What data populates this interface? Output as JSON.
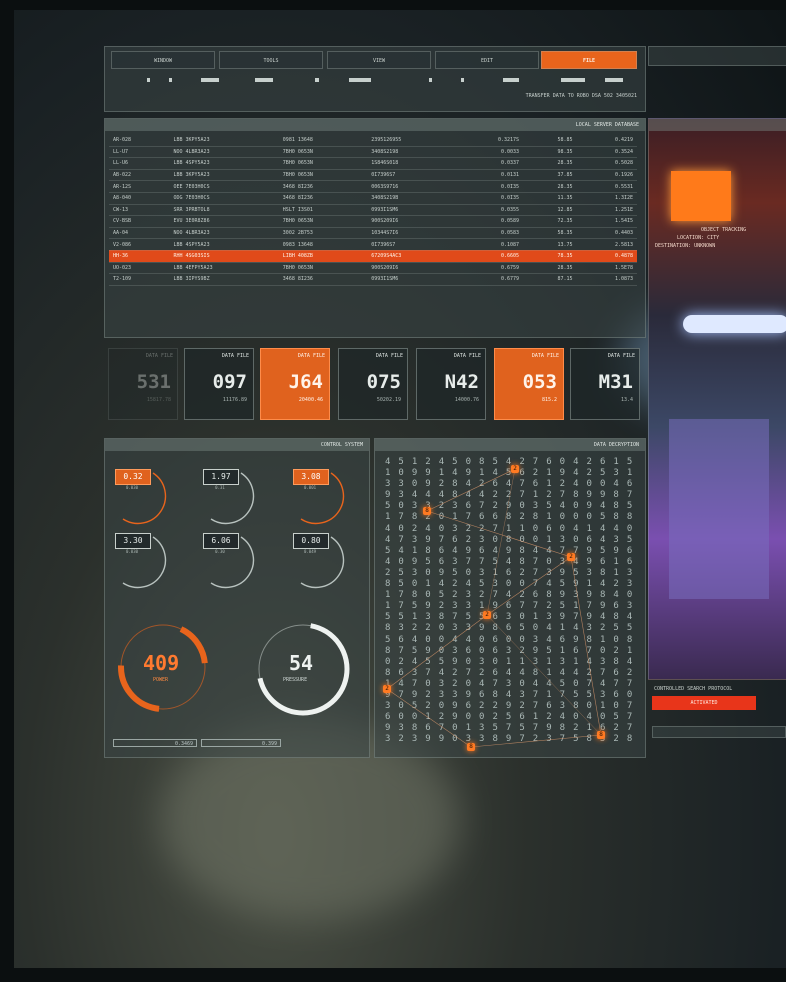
{
  "menu": {
    "items": [
      "WINDOW",
      "TOOLS",
      "VIEW",
      "EDIT",
      "FILE"
    ],
    "active": "FILE"
  },
  "transfer_text": "TRANSFER DATA TO ROBO DSA 502 3405021",
  "database": {
    "title": "LOCAL SERVER DATABASE",
    "rows": [
      [
        "AR-028",
        "LBB 3KPY5A23",
        "0981 13648",
        "2395126955",
        "0.3217S",
        "58.85",
        "0.4219"
      ],
      [
        "LL-U7",
        "NOO 4LBR3A23",
        "7BH0 0653N",
        "3408S2198",
        "0.0033",
        "98.35",
        "0.3524"
      ],
      [
        "LL-U6",
        "LBB 4SPY5A23",
        "7BH0 0653N",
        "1S846S018",
        "0.0337",
        "28.35",
        "0.5028"
      ],
      [
        "AB-022",
        "LBB 3KPY5A23",
        "7BH0 0653N",
        "0I7396S7",
        "0.0131",
        "37.85",
        "0.1926"
      ],
      [
        "AR-12S",
        "OEE 7E03H0CS",
        "3468 8I236",
        "0063S9716",
        "0.0I35",
        "28.35",
        "0.5531"
      ],
      [
        "A8-040",
        "ODG 7E03H0CS",
        "3468 8I236",
        "3408S219B",
        "0.0I35",
        "11.35",
        "1.3I2E"
      ],
      [
        "CW-13",
        "SRR 3PRBTOL8",
        "HSLT I3S01",
        "0993I1SM6",
        "0.0355",
        "12.85",
        "1.251E"
      ],
      [
        "CV-BSB",
        "EVU 3E0R8Z86",
        "7BH0 0653N",
        "900S209I6",
        "0.0589",
        "72.35",
        "1.54I5"
      ],
      [
        "AA-04",
        "NOO 4LBR3A23",
        "3002 2B753",
        "10344S7I6",
        "0.0583",
        "58.35",
        "0.4403"
      ],
      [
        "V2-086",
        "LBB 4SPY5A23",
        "0983 13648",
        "0I7396S7",
        "0.1087",
        "13.75",
        "2.5813"
      ],
      [
        "HH-36",
        "RHH 4SG03SIS",
        "LIBH 408ZB",
        "67209S4AC3",
        "0.6605",
        "78.35",
        "0.4878"
      ],
      [
        "UO-023",
        "LBB 4EFPY5A23",
        "7BH0 0653N",
        "900S209I6",
        "0.6759",
        "28.35",
        "1.5E78"
      ],
      [
        "T2-109",
        "LBB 3IPYS9BZ",
        "3468 8I236",
        "0993I1SM6",
        "0.6779",
        "87.15",
        "1.0873"
      ]
    ],
    "highlight_row": 10
  },
  "data_files": [
    {
      "label": "DATA FILE",
      "code": "M31",
      "sub": "13.4",
      "orange": false
    },
    {
      "label": "DATA FILE",
      "code": "053",
      "sub": "815.2",
      "orange": true
    },
    {
      "label": "DATA FILE",
      "code": "N42",
      "sub": "14000.76",
      "orange": false
    },
    {
      "label": "DATA FILE",
      "code": "075",
      "sub": "50202.19",
      "orange": false
    },
    {
      "label": "DATA FILE",
      "code": "J64",
      "sub": "20400.46",
      "orange": true
    },
    {
      "label": "DATA FILE",
      "code": "097",
      "sub": "11176.89",
      "orange": false
    },
    {
      "label": "DATA FILE",
      "code": "531",
      "sub": "15817.78",
      "orange": false
    }
  ],
  "control": {
    "title": "CONTROL SYSTEM",
    "gauges": [
      {
        "value": "3.08",
        "sub": "0.001",
        "orange": true
      },
      {
        "value": "1.97",
        "sub": "0.31",
        "orange": false
      },
      {
        "value": "0.32",
        "sub": "0.030",
        "orange": true
      },
      {
        "value": "0.80",
        "sub": "0.049",
        "orange": false
      },
      {
        "value": "6.06",
        "sub": "0.30",
        "orange": false
      },
      {
        "value": "3.30",
        "sub": "0.030",
        "orange": false
      }
    ],
    "pressure": {
      "value": "54",
      "label": "PRESSURE"
    },
    "power": {
      "value": "409",
      "label": "POWER"
    },
    "footer_left": "0.399",
    "footer_right": "0.3469"
  },
  "decryption": {
    "title": "DATA DECRYPTION",
    "nodes": [
      "2",
      "8",
      "2",
      "2",
      "2",
      "8",
      "8"
    ]
  },
  "right_panel": {
    "tracking_lines": [
      "OBJECT TRACKING",
      "LOCATION: CITY",
      "DESTINATION: UNKNOWN"
    ],
    "protocol_label": "CONTROLLED SEARCH PROTOCOL",
    "activate_label": "ACTIVATED"
  },
  "colors": {
    "accent": "#e8641c",
    "highlight": "#e04a1a",
    "panel": "#3a4646"
  }
}
